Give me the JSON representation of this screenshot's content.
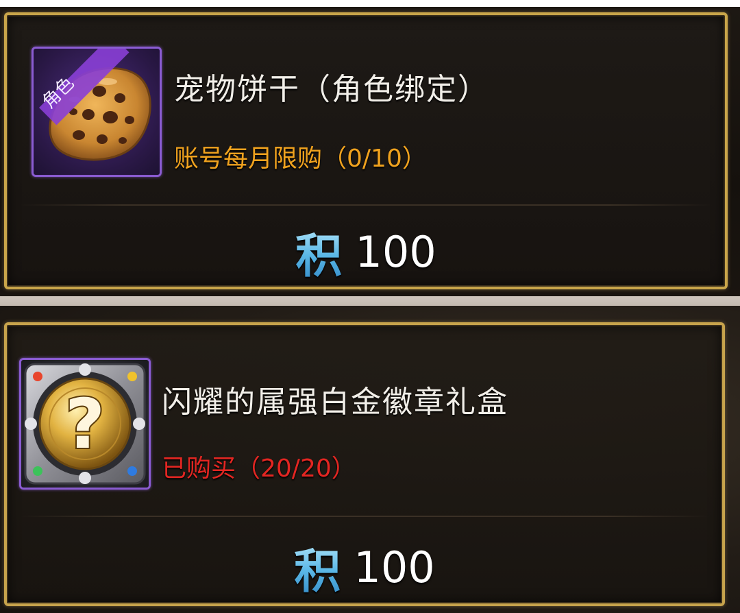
{
  "shop_items": [
    {
      "name": "宠物饼干（角色绑定）",
      "icon": "cookie-icon",
      "icon_badge": "角色",
      "limit_text": "账号每月限购（0/10）",
      "limit_color": "#f0a21e",
      "price_icon": "积",
      "price": "100"
    },
    {
      "name": "闪耀的属强白金徽章礼盒",
      "icon": "mystery-box-icon",
      "limit_text": "已购买（20/20）",
      "limit_color": "#e32622",
      "price_icon": "积",
      "price": "100"
    }
  ],
  "colors": {
    "card_border": "#c9a54a",
    "icon_frame": "#8a5bd1",
    "price_icon": "#5ab7e6"
  }
}
